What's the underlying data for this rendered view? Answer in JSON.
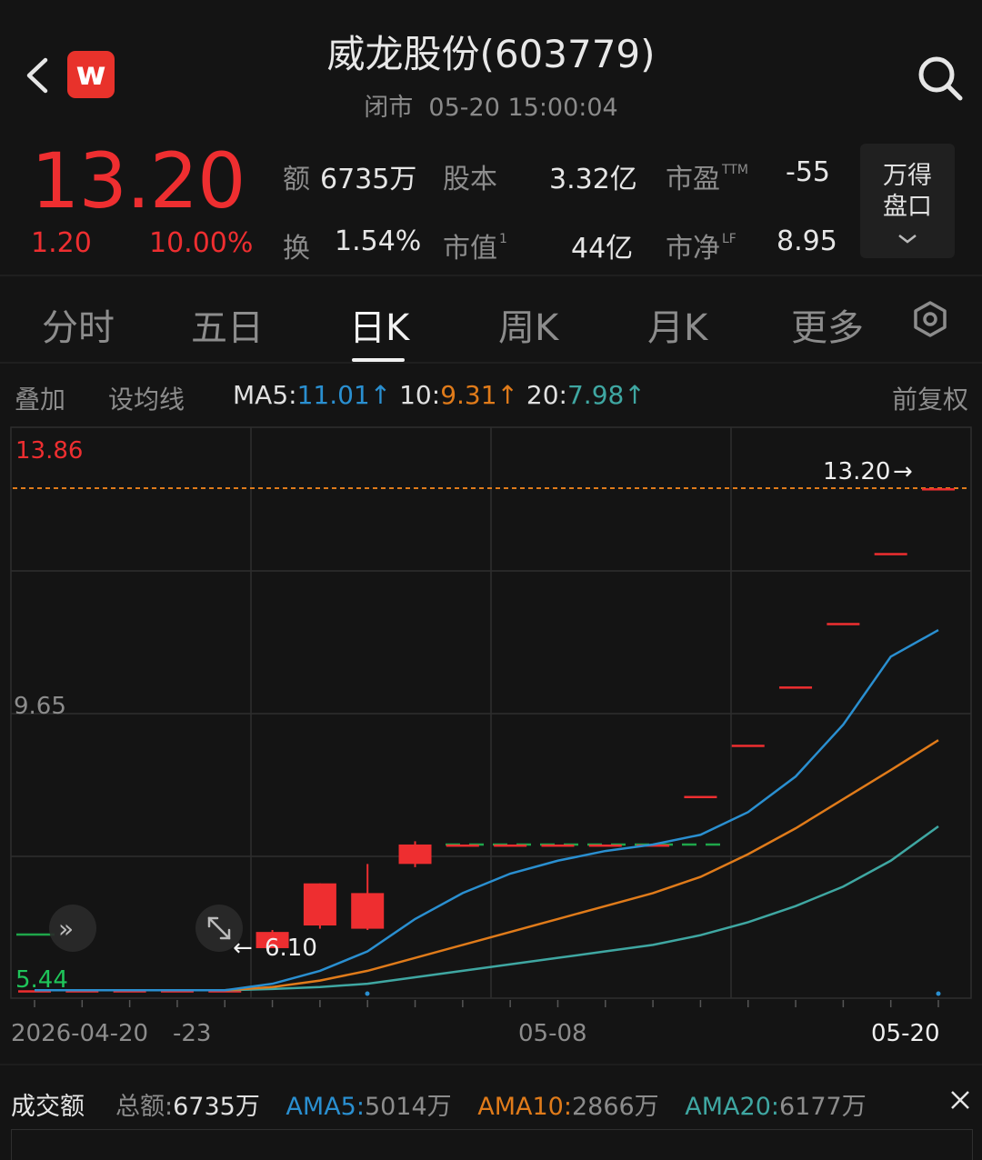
{
  "header": {
    "title": "威龙股份(603779)",
    "status": "闭市",
    "datetime": "05-20 15:00:04",
    "logo_letter": "w"
  },
  "quote": {
    "price": "13.20",
    "change": "1.20",
    "change_pct": "10.00%",
    "price_color": "#ee2e30",
    "stats": {
      "amount_label": "额",
      "amount": "6735万",
      "turnover_label": "换",
      "turnover": "1.54%",
      "share_capital_label": "股本",
      "share_capital": "3.32亿",
      "mkt_cap_label": "市值",
      "mkt_cap_sup": "1",
      "mkt_cap": "44亿",
      "pe_label": "市盈",
      "pe_sup": "TTM",
      "pe": "-55",
      "pb_label": "市净",
      "pb_sup": "LF",
      "pb": "8.95"
    },
    "panel_button": [
      "万得",
      "盘口"
    ]
  },
  "tabs": [
    "分时",
    "五日",
    "日K",
    "周K",
    "月K",
    "更多"
  ],
  "active_tab": "日K",
  "ma_bar": {
    "overlay": "叠加",
    "set_ma": "设均线",
    "ma5_label": "MA5",
    "ma5": "11.01↑",
    "ma10_label": "10",
    "ma10": "9.31↑",
    "ma20_label": "20",
    "ma20": "7.98↑",
    "adjust": "前复权",
    "colors": {
      "ma5": "#2a8fd0",
      "ma10": "#e07b1a",
      "ma20": "#3fa7a2"
    }
  },
  "chart_data": {
    "type": "candlestick",
    "y_labels": {
      "top": "13.86",
      "mid": "9.65",
      "bottom": "5.44"
    },
    "last_price_label": "13.20",
    "low_marker_label": "6.10",
    "x_labels": [
      "2026-04-20",
      "-23",
      "05-08",
      "05-20"
    ],
    "ylim": [
      5.44,
      13.86
    ],
    "candles": [
      {
        "o": 5.45,
        "c": 5.45,
        "h": 5.45,
        "l": 5.45
      },
      {
        "o": 5.45,
        "c": 5.45,
        "h": 5.45,
        "l": 5.45
      },
      {
        "o": 5.45,
        "c": 5.45,
        "h": 5.45,
        "l": 5.45
      },
      {
        "o": 5.45,
        "c": 5.45,
        "h": 5.45,
        "l": 5.45
      },
      {
        "o": 5.45,
        "c": 5.45,
        "h": 5.45,
        "l": 5.45
      },
      {
        "o": 6.1,
        "c": 6.35,
        "h": 6.38,
        "l": 6.1
      },
      {
        "o": 6.45,
        "c": 7.1,
        "h": 7.1,
        "l": 6.4
      },
      {
        "o": 6.4,
        "c": 6.95,
        "h": 7.4,
        "l": 6.38
      },
      {
        "o": 7.4,
        "c": 7.7,
        "h": 7.75,
        "l": 7.35
      },
      {
        "o": 7.7,
        "c": 7.7,
        "h": 7.7,
        "l": 7.7
      },
      {
        "o": 7.7,
        "c": 7.7,
        "h": 7.7,
        "l": 7.7
      },
      {
        "o": 7.7,
        "c": 7.7,
        "h": 7.7,
        "l": 7.7
      },
      {
        "o": 7.7,
        "c": 7.7,
        "h": 7.7,
        "l": 7.7
      },
      {
        "o": 7.7,
        "c": 7.7,
        "h": 7.7,
        "l": 7.7
      },
      {
        "o": 8.45,
        "c": 8.45,
        "h": 8.45,
        "l": 8.45
      },
      {
        "o": 9.24,
        "c": 9.24,
        "h": 9.24,
        "l": 9.24
      },
      {
        "o": 10.14,
        "c": 10.14,
        "h": 10.14,
        "l": 10.14
      },
      {
        "o": 11.12,
        "c": 11.12,
        "h": 11.12,
        "l": 11.12
      },
      {
        "o": 12.2,
        "c": 12.2,
        "h": 12.2,
        "l": 12.2
      },
      {
        "o": 13.2,
        "c": 13.2,
        "h": 13.2,
        "l": 13.2
      }
    ],
    "ma5": [
      5.45,
      5.45,
      5.45,
      5.45,
      5.45,
      5.55,
      5.75,
      6.05,
      6.55,
      6.95,
      7.25,
      7.45,
      7.6,
      7.7,
      7.85,
      8.2,
      8.75,
      9.55,
      10.6,
      11.01
    ],
    "ma10": [
      5.45,
      5.45,
      5.45,
      5.45,
      5.45,
      5.5,
      5.6,
      5.75,
      5.95,
      6.15,
      6.35,
      6.55,
      6.75,
      6.95,
      7.2,
      7.55,
      7.95,
      8.4,
      8.85,
      9.31
    ],
    "ma20": [
      5.45,
      5.45,
      5.45,
      5.45,
      5.45,
      5.47,
      5.5,
      5.55,
      5.65,
      5.75,
      5.85,
      5.95,
      6.05,
      6.15,
      6.3,
      6.5,
      6.75,
      7.05,
      7.45,
      7.98
    ]
  },
  "volume_bar": {
    "title": "成交额",
    "total_label": "总额",
    "total": "6735万",
    "ama5_label": "AMA5",
    "ama5": "5014万",
    "ama10_label": "AMA10",
    "ama10": "2866万",
    "ama20_label": "AMA20",
    "ama20": "6177万"
  }
}
